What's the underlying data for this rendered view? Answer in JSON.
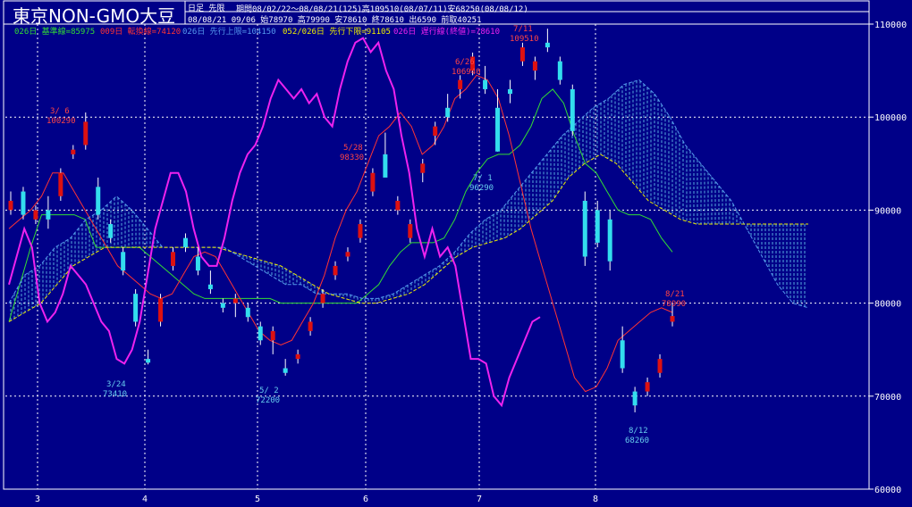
{
  "header": {
    "title": "東京NON-GMO大豆",
    "subtitle": "日足 先限",
    "period": "期間08/02/22～08/08/21(125)高109510(08/07/11)安68250(08/08/12)",
    "lastbar": "08/08/21 09/06 始78970 高79990 安78610 終78610 出6590 前取40251"
  },
  "legend": [
    {
      "text": "026日 基準線=85975",
      "color": "#33dd33"
    },
    {
      "text": "009日 転換線=74120",
      "color": "#ff3333"
    },
    {
      "text": "026日 先行上限=104150",
      "color": "#5599ee"
    },
    {
      "text": "052/026日 先行下限=91105",
      "color": "#eeee00"
    },
    {
      "text": "026日 遅行線(終値)=78610",
      "color": "#ee22ee"
    }
  ],
  "chart_data": {
    "type": "candlestick",
    "ylim": [
      60000,
      110000
    ],
    "yticks": [
      "110000",
      "100000",
      "90000",
      "80000",
      "70000",
      "60000"
    ],
    "xticks": [
      "3",
      "4",
      "5",
      "6",
      "7",
      "8"
    ],
    "series": [
      {
        "name": "基準線",
        "color": "#33dd33",
        "values": [
          78000,
          82000,
          86000,
          89500,
          89500,
          89500,
          89500,
          89000,
          86000,
          86000,
          86000,
          86000,
          86000,
          85000,
          84000,
          83000,
          82000,
          81000,
          80500,
          80500,
          80500,
          80500,
          80500,
          80500,
          80500,
          80000,
          80000,
          80000,
          80000,
          80000,
          80000,
          80000,
          80000,
          81000,
          82000,
          84000,
          85500,
          86500,
          86500,
          86500,
          87000,
          89000,
          92000,
          94000,
          95500,
          96000,
          96000,
          97000,
          99000,
          102000,
          103000,
          101500,
          98000,
          95000,
          94000,
          92000,
          90000,
          89500,
          89500,
          89000,
          87000,
          85500
        ]
      },
      {
        "name": "転換線",
        "color": "#ff3333",
        "values": [
          88000,
          89000,
          90000,
          91500,
          94000,
          94000,
          92000,
          90000,
          88000,
          86000,
          84000,
          83000,
          82000,
          81000,
          80500,
          81000,
          83000,
          85000,
          85500,
          85000,
          83000,
          81000,
          79000,
          77000,
          76000,
          75500,
          76000,
          78000,
          80000,
          83000,
          87000,
          90000,
          92000,
          95000,
          98000,
          99000,
          100500,
          99000,
          96000,
          97000,
          99000,
          102000,
          103000,
          104500,
          104000,
          102000,
          98000,
          93000,
          88000,
          84000,
          80000,
          76000,
          72000,
          70500,
          71000,
          73000,
          76000,
          77000,
          78000,
          79000,
          79500,
          79000
        ]
      },
      {
        "name": "先行上限",
        "color": "#5599ee",
        "values": [
          80000,
          83000,
          84000,
          86000,
          87000,
          89000,
          90000,
          91500,
          90000,
          88000,
          86000,
          86000,
          86000,
          86000,
          86000,
          85000,
          84000,
          83000,
          82000,
          82000,
          81000,
          81000,
          81000,
          80500,
          80500,
          81000,
          82000,
          83000,
          84000,
          85500,
          87500,
          89000,
          90000,
          92000,
          94000,
          96000,
          98000,
          99500,
          101000,
          102000,
          103500,
          104000,
          102500,
          100000,
          97000,
          95000,
          93000,
          91000,
          88000,
          85000,
          82000,
          80000,
          79500
        ]
      },
      {
        "name": "先行下限",
        "color": "#eeee00",
        "values": [
          78000,
          79000,
          80000,
          82000,
          84000,
          85000,
          86000,
          86000,
          86000,
          86000,
          86000,
          86000,
          86000,
          86000,
          85500,
          85000,
          84500,
          84000,
          83000,
          82000,
          81000,
          80500,
          80000,
          80000,
          80500,
          81000,
          82000,
          83500,
          85000,
          86000,
          86500,
          87000,
          88000,
          89500,
          91000,
          93500,
          95000,
          96000,
          95000,
          93000,
          91000,
          90000,
          89000,
          88500,
          88500,
          88500,
          88500,
          88500,
          88500,
          88500,
          88500
        ]
      },
      {
        "name": "遅行線",
        "color": "#ee22ee",
        "values": [
          82000,
          85000,
          88000,
          86000,
          80000,
          78000,
          79000,
          81000,
          84000,
          83000,
          82000,
          80000,
          78000,
          77000,
          74000,
          73500,
          75000,
          78000,
          83000,
          88000,
          91000,
          94000,
          94000,
          92000,
          88000,
          85000,
          84000,
          84000,
          87000,
          91000,
          94000,
          96000,
          97000,
          99000,
          102000,
          104000,
          103000,
          102000,
          103000,
          101500,
          102500,
          100000,
          99000,
          103000,
          106000,
          108000,
          108500,
          107000,
          108000,
          105000,
          103000,
          98000,
          94000,
          88000,
          85000,
          88000,
          85000,
          86000,
          84000,
          79000,
          74000,
          74000,
          73500,
          70000,
          69000,
          72000,
          74000,
          76000,
          78000,
          78500
        ]
      }
    ],
    "candles": [
      [
        90000,
        92000,
        89500,
        91000
      ],
      [
        92000,
        92500,
        89000,
        89500
      ],
      [
        89000,
        90500,
        88500,
        90000
      ],
      [
        90000,
        91500,
        88000,
        89000
      ],
      [
        91500,
        94500,
        91000,
        94000
      ],
      [
        96000,
        97000,
        95500,
        96500
      ],
      [
        97000,
        100500,
        96500,
        99500
      ],
      [
        92500,
        93500,
        89000,
        89500
      ],
      [
        88500,
        89000,
        86500,
        87000
      ],
      [
        85500,
        86000,
        83000,
        83500
      ],
      [
        81000,
        81500,
        77500,
        78000
      ],
      [
        74000,
        75000,
        73410,
        73600
      ],
      [
        78000,
        81000,
        77500,
        80500
      ],
      [
        84000,
        86000,
        83500,
        85500
      ],
      [
        87000,
        87500,
        85500,
        86000
      ],
      [
        85000,
        86000,
        83000,
        83500
      ],
      [
        82000,
        83500,
        81000,
        81500
      ],
      [
        80000,
        80500,
        79000,
        79500
      ],
      [
        80000,
        81000,
        78500,
        80500
      ],
      [
        79500,
        80000,
        78000,
        78500
      ],
      [
        77500,
        78000,
        75500,
        76000
      ],
      [
        76000,
        77500,
        74500,
        77000
      ],
      [
        73000,
        74000,
        72200,
        72500
      ],
      [
        74000,
        75000,
        73500,
        74500
      ],
      [
        77000,
        78500,
        76500,
        78000
      ],
      [
        80000,
        81500,
        79500,
        81000
      ],
      [
        83000,
        84500,
        82500,
        84000
      ],
      [
        85000,
        86000,
        84500,
        85500
      ],
      [
        87000,
        89000,
        86500,
        88500
      ],
      [
        92000,
        94500,
        91500,
        94000
      ],
      [
        96000,
        98330,
        95500,
        93500
      ],
      [
        90000,
        91500,
        89500,
        91000
      ],
      [
        87000,
        89000,
        86500,
        88500
      ],
      [
        94000,
        95500,
        93000,
        95000
      ],
      [
        98000,
        99500,
        97000,
        99000
      ],
      [
        101000,
        102500,
        99500,
        100000
      ],
      [
        103000,
        104500,
        102000,
        104000
      ],
      [
        105000,
        106940,
        104500,
        106500
      ],
      [
        104000,
        105500,
        102500,
        103000
      ],
      [
        101000,
        103000,
        96290,
        96300
      ],
      [
        103000,
        104000,
        101500,
        102500
      ],
      [
        106000,
        108000,
        105500,
        107500
      ],
      [
        105000,
        106500,
        104000,
        106000
      ],
      [
        108000,
        109510,
        107000,
        107500
      ],
      [
        106000,
        106500,
        103500,
        104000
      ],
      [
        103000,
        103500,
        98000,
        98500
      ],
      [
        91000,
        92000,
        84000,
        85000
      ],
      [
        90000,
        91000,
        86000,
        86500
      ],
      [
        89000,
        90000,
        83500,
        84500
      ],
      [
        76000,
        77500,
        72500,
        73000
      ],
      [
        70500,
        71000,
        68260,
        69000
      ],
      [
        70500,
        72000,
        70000,
        71500
      ],
      [
        72500,
        74500,
        72000,
        74000
      ],
      [
        78000,
        79990,
        77500,
        78610
      ]
    ],
    "annotations": [
      {
        "text": "3/ 6",
        "text2": "100290",
        "color": "#ff4444"
      },
      {
        "text": "3/24",
        "text2": "73410",
        "color": "#66ccee"
      },
      {
        "text": "5/ 2",
        "text2": "72200",
        "color": "#66ccee"
      },
      {
        "text": "5/28",
        "text2": "98330",
        "color": "#ff4444"
      },
      {
        "text": "6/26",
        "text2": "106940",
        "color": "#ff4444"
      },
      {
        "text": "7/ 1",
        "text2": "96290",
        "color": "#66ccee"
      },
      {
        "text": "7/11",
        "text2": "109510",
        "color": "#ff4444"
      },
      {
        "text": "8/12",
        "text2": "68260",
        "color": "#66ccee"
      },
      {
        "text": "8/21",
        "text2": "78990",
        "color": "#ff4444"
      }
    ],
    "grid": true
  },
  "colors": {
    "background": "#000088",
    "grid": "#ffffff",
    "up": "#dd1111",
    "down": "#33ddee"
  }
}
